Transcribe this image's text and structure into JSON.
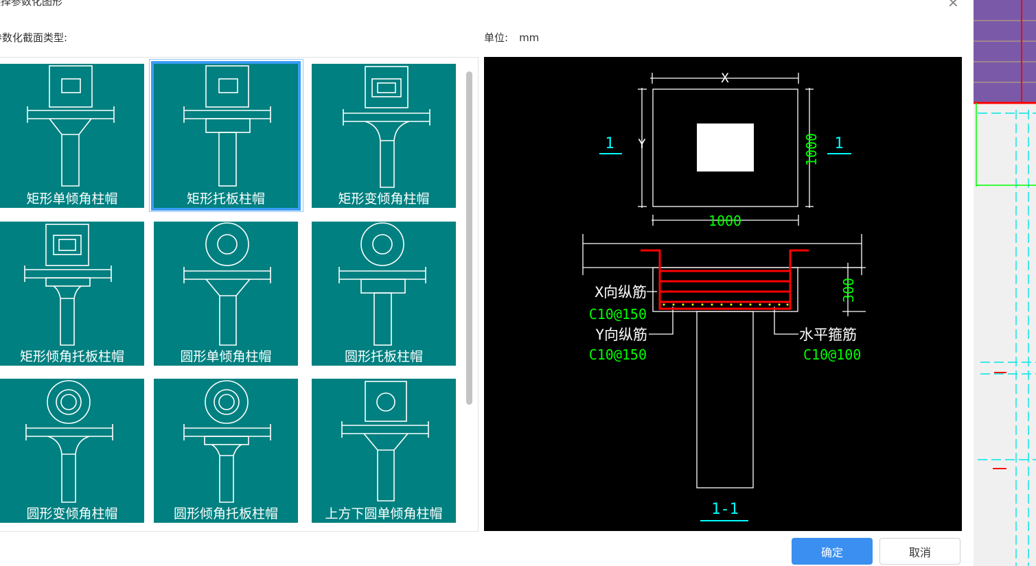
{
  "dialog": {
    "title": "选择参数化图形",
    "section_label": "参数化截面类型:",
    "unit_label": "单位:",
    "unit_value": "mm",
    "ok_label": "确定",
    "cancel_label": "取消"
  },
  "gallery": {
    "selected_index": 1,
    "items": [
      {
        "label": "矩形单倾角柱帽"
      },
      {
        "label": "矩形托板柱帽"
      },
      {
        "label": "矩形变倾角柱帽"
      },
      {
        "label": "矩形倾角托板柱帽"
      },
      {
        "label": "圆形单倾角柱帽"
      },
      {
        "label": "圆形托板柱帽"
      },
      {
        "label": "圆形变倾角柱帽"
      },
      {
        "label": "圆形倾角托板柱帽"
      },
      {
        "label": "上方下圆单倾角柱帽"
      }
    ]
  },
  "preview": {
    "dim_x": "X",
    "dim_y": "Y",
    "dim_width": "1000",
    "dim_height": "1000",
    "dim_thickness": "300",
    "section_mark": "1",
    "section_title": "1-1",
    "rebar_x_label": "X向纵筋",
    "rebar_x_value": "C10@150",
    "rebar_y_label": "Y向纵筋",
    "rebar_y_value": "C10@150",
    "stirrup_label": "水平箍筋",
    "stirrup_value": "C10@100"
  },
  "colors": {
    "tile_bg": "#008080",
    "selected_border": "#3b9cf5",
    "ok_button": "#3b8ff0",
    "cad_white": "#ffffff",
    "cad_green": "#00ff00",
    "cad_cyan": "#00ffff",
    "cad_red": "#ff0000",
    "cad_yellow": "#ffff00"
  }
}
